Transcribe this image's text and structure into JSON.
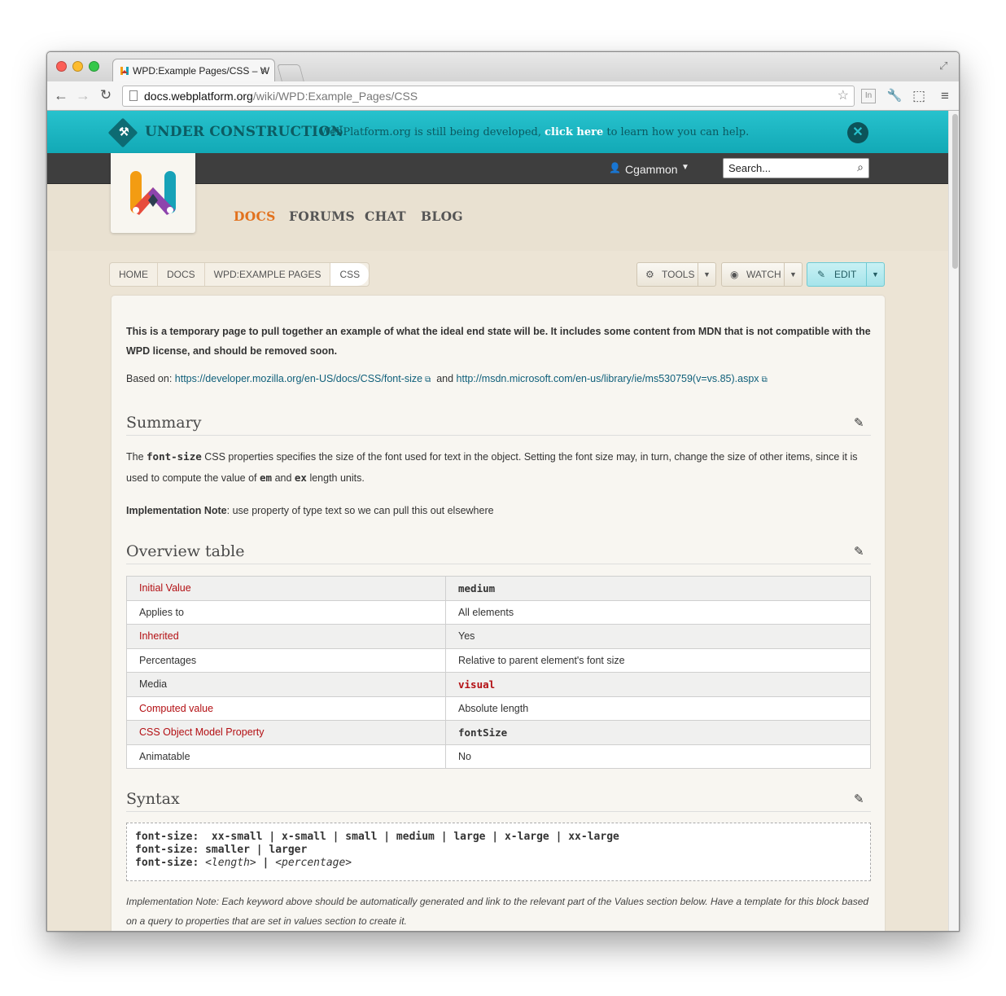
{
  "browser": {
    "tab_title": "WPD:Example Pages/CSS – W",
    "url_host": "docs.webplatform.org",
    "url_path": "/wiki/WPD:Example_Pages/CSS"
  },
  "banner": {
    "title": "UNDER CONSTRUCTION",
    "text_before": "WebPlatform.org is still being developed,",
    "link": "click here",
    "text_after": "to learn how you can help."
  },
  "userbar": {
    "username": "Cgammon",
    "search_placeholder": "Search..."
  },
  "nav": {
    "items": [
      "DOCS",
      "FORUMS",
      "CHAT",
      "BLOG"
    ]
  },
  "breadcrumb": [
    "HOME",
    "DOCS",
    "WPD:EXAMPLE PAGES",
    "CSS"
  ],
  "actions": {
    "tools": "TOOLS",
    "watch": "WATCH",
    "edit": "EDIT"
  },
  "content": {
    "intro": "This is a temporary page to pull together an example of what the ideal end state will be. It includes some content from MDN that is not compatible with the WPD license, and should be removed soon.",
    "based_on_label": "Based on:",
    "based_on_link1": "https://developer.mozilla.org/en-US/docs/CSS/font-size",
    "based_on_and": "and",
    "based_on_link2": "http://msdn.microsoft.com/en-us/library/ie/ms530759(v=vs.85).aspx",
    "summary_heading": "Summary",
    "summary_p1_a": "The",
    "summary_p1_code": "font-size",
    "summary_p1_b": "CSS properties specifies the size of the font used for text in the object. Setting the font size may, in turn, change the size of other items, since it is used to compute the value of",
    "summary_p1_em": "em",
    "summary_p1_and": "and",
    "summary_p1_ex": "ex",
    "summary_p1_c": "length units.",
    "impl_label": "Implementation Note",
    "impl_text": ": use property of type text so we can pull this out elsewhere",
    "overview_heading": "Overview table",
    "overview_rows": [
      {
        "label": "Initial Value",
        "value": "medium"
      },
      {
        "label": "Applies to",
        "value": "All elements"
      },
      {
        "label": "Inherited",
        "value": "Yes"
      },
      {
        "label": "Percentages",
        "value": "Relative to parent element's font size"
      },
      {
        "label": "Media",
        "value": "visual"
      },
      {
        "label": "Computed value",
        "value": "Absolute length"
      },
      {
        "label": "CSS Object Model Property",
        "value": "fontSize"
      },
      {
        "label": "Animatable",
        "value": "No"
      }
    ],
    "syntax_heading": "Syntax",
    "syntax_line1_prop": "font-size:",
    "syntax_line1_vals": " xx-small | x-small | small | medium | large | x-large | xx-large",
    "syntax_line2_prop": "font-size:",
    "syntax_line2_vals": "smaller | larger",
    "syntax_line3_prop": "font-size:",
    "syntax_line3_len": "<length>",
    "syntax_line3_sep": " | ",
    "syntax_line3_pct": "<percentage>",
    "syntax_note": "Implementation Note: Each keyword above should be automatically generated and link to the relevant part of the Values section below. Have a template for this block based on a query to properties that are set in values section to create it."
  }
}
